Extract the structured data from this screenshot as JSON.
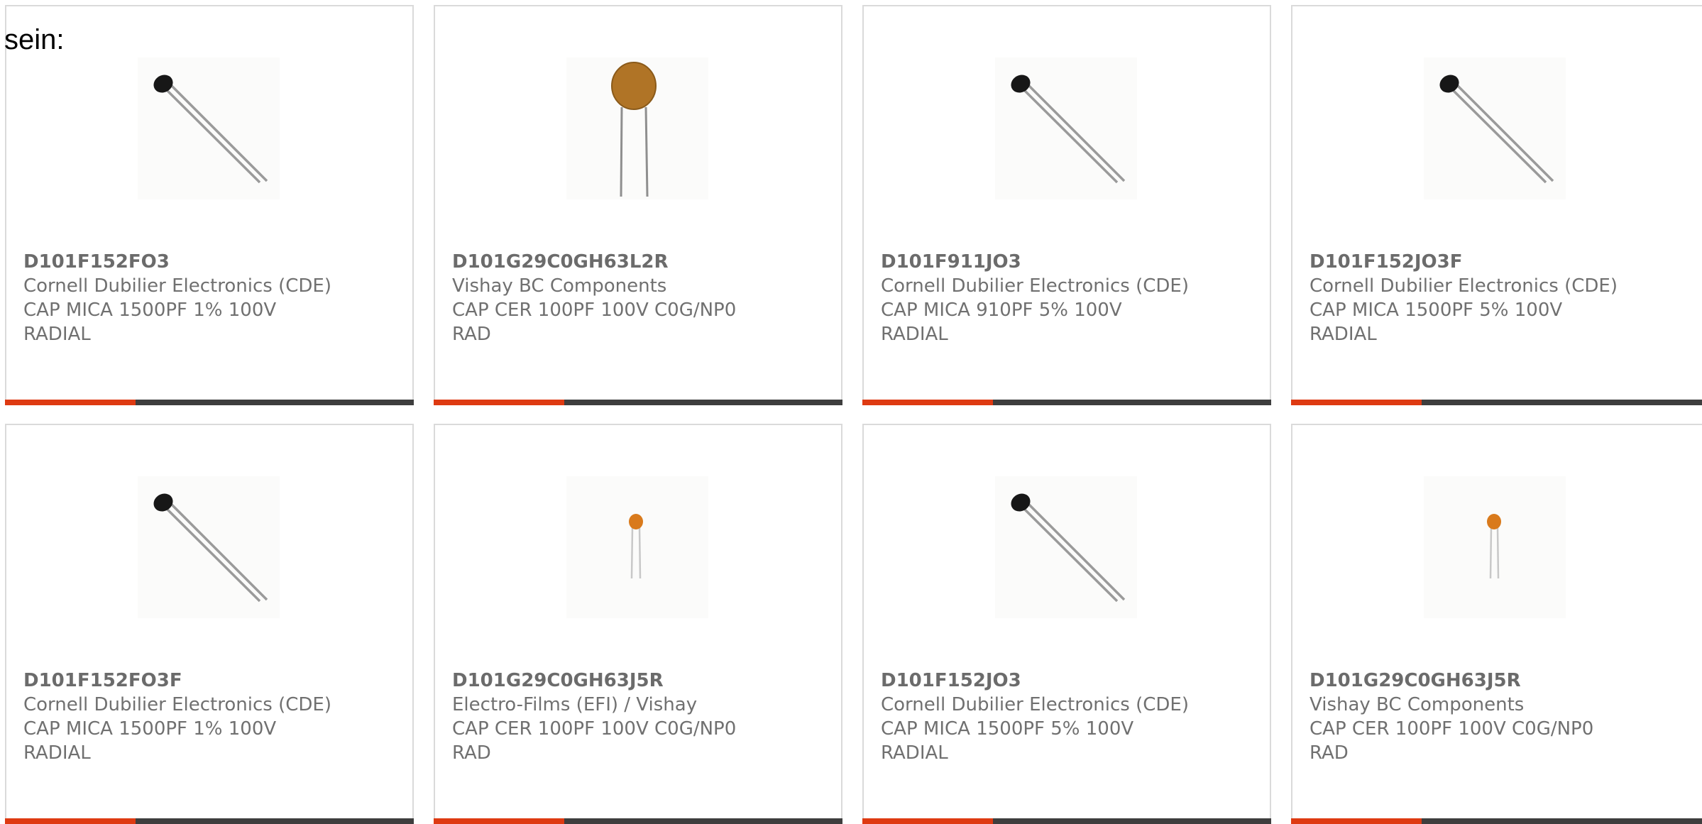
{
  "intro_text": "sein:",
  "products": [
    {
      "part": "D101F152FO3",
      "maker": "Cornell Dubilier Electronics (CDE)",
      "desc1": "CAP MICA 1500PF 1% 100V",
      "desc2": "RADIAL",
      "image": "mica-capacitor"
    },
    {
      "part": "D101G29C0GH63L2R",
      "maker": "Vishay BC Components",
      "desc1": "CAP CER 100PF 100V C0G/NP0",
      "desc2": "RAD",
      "image": "ceramic-disc-capacitor-large"
    },
    {
      "part": "D101F911JO3",
      "maker": "Cornell Dubilier Electronics (CDE)",
      "desc1": "CAP MICA 910PF 5% 100V",
      "desc2": "RADIAL",
      "image": "mica-capacitor"
    },
    {
      "part": "D101F152JO3F",
      "maker": "Cornell Dubilier Electronics (CDE)",
      "desc1": "CAP MICA 1500PF 5% 100V",
      "desc2": "RADIAL",
      "image": "mica-capacitor"
    },
    {
      "part": "D101F152FO3F",
      "maker": "Cornell Dubilier Electronics (CDE)",
      "desc1": "CAP MICA 1500PF 1% 100V",
      "desc2": "RADIAL",
      "image": "mica-capacitor"
    },
    {
      "part": "D101G29C0GH63J5R",
      "maker": "Electro-Films (EFI) / Vishay",
      "desc1": "CAP CER 100PF 100V C0G/NP0",
      "desc2": "RAD",
      "image": "ceramic-disc-capacitor-small"
    },
    {
      "part": "D101F152JO3",
      "maker": "Cornell Dubilier Electronics (CDE)",
      "desc1": "CAP MICA 1500PF 5% 100V",
      "desc2": "RADIAL",
      "image": "mica-capacitor"
    },
    {
      "part": "D101G29C0GH63J5R",
      "maker": "Vishay BC Components",
      "desc1": "CAP CER 100PF 100V C0G/NP0",
      "desc2": "RAD",
      "image": "ceramic-disc-capacitor-small"
    }
  ],
  "colors": {
    "accent": "#de3a12",
    "bar": "#3e3e3e",
    "border": "#dadada",
    "text": "#707070"
  }
}
